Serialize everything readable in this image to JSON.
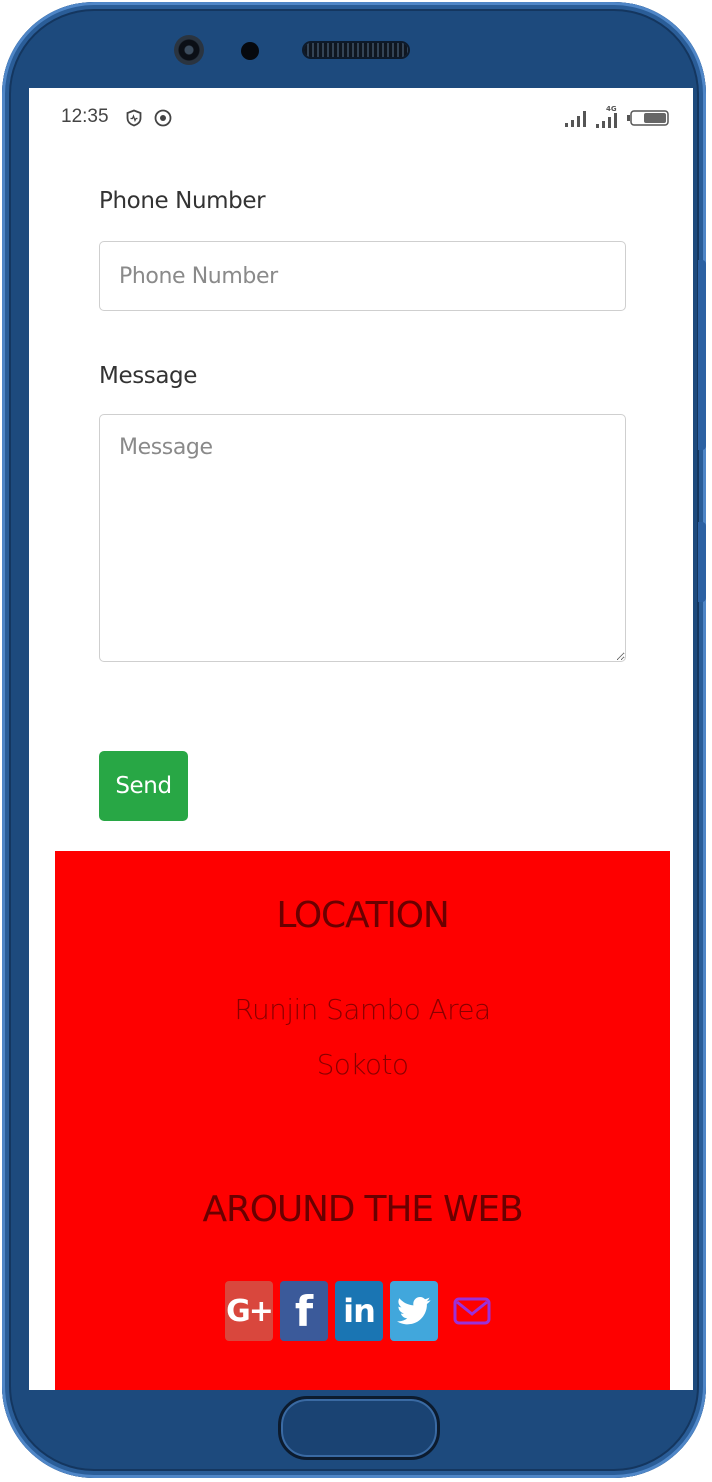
{
  "status_bar": {
    "time": "12:35",
    "network": "4G",
    "icons": [
      "shield-icon",
      "eye-icon",
      "signal-icon",
      "signal-4g-icon",
      "battery-icon"
    ]
  },
  "form": {
    "phone": {
      "label": "Phone Number",
      "placeholder": "Phone Number",
      "value": ""
    },
    "message": {
      "label": "Message",
      "placeholder": "Message",
      "value": ""
    },
    "send_label": "Send"
  },
  "footer": {
    "location_heading": "LOCATION",
    "address_line1": "Runjin Sambo Area",
    "address_line2": "Sokoto",
    "web_heading": "AROUND THE WEB",
    "social_links": [
      {
        "icon": "google-plus-icon",
        "glyph": "G+"
      },
      {
        "icon": "facebook-icon",
        "glyph": "f"
      },
      {
        "icon": "linkedin-icon",
        "glyph": "in"
      },
      {
        "icon": "twitter-icon"
      },
      {
        "icon": "email-icon"
      }
    ]
  },
  "colors": {
    "frame": "#1d4a7d",
    "footer_bg": "#fe0000",
    "footer_text": "#6a0000",
    "send_button": "#28a745",
    "google_plus": "#d9473d",
    "facebook": "#3b5a9a",
    "linkedin": "#1a75b3",
    "twitter": "#41a7dc",
    "email_icon": "#9b30d9"
  }
}
